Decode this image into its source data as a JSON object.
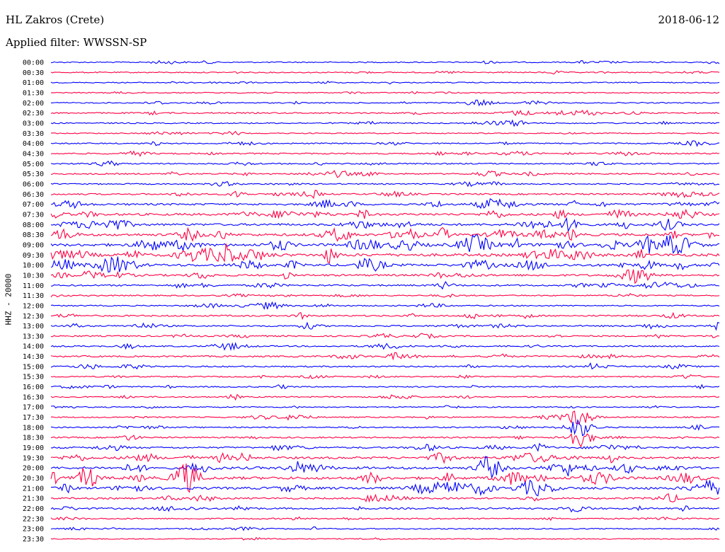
{
  "header": {
    "station": "HL Zakros (Crete)",
    "date": "2018-06-12",
    "filter_label": "Applied filter: WWSSN-SP"
  },
  "chart_data": {
    "type": "line",
    "title": "HL Zakros (Crete)",
    "subtitle": "Applied filter: WWSSN-SP",
    "ylabel": "HHZ - 20000",
    "colors": {
      "even_rows": "#0000ff",
      "odd_rows": "#ff0044"
    },
    "rows": [
      "00:00",
      "00:30",
      "01:00",
      "01:30",
      "02:00",
      "02:30",
      "03:00",
      "03:30",
      "04:00",
      "04:30",
      "05:00",
      "05:30",
      "06:00",
      "06:30",
      "07:00",
      "07:30",
      "08:00",
      "08:30",
      "09:00",
      "09:30",
      "10:00",
      "10:30",
      "11:00",
      "11:30",
      "12:00",
      "12:30",
      "13:00",
      "13:30",
      "14:00",
      "14:30",
      "15:00",
      "15:30",
      "16:00",
      "16:30",
      "17:00",
      "17:30",
      "18:00",
      "18:30",
      "19:00",
      "19:30",
      "20:00",
      "20:30",
      "21:00",
      "21:30",
      "22:00",
      "22:30",
      "23:00",
      "23:30"
    ],
    "noise_level": [
      1,
      1,
      0.8,
      0.8,
      1,
      1.5,
      1.2,
      0.8,
      1.2,
      1.5,
      1.3,
      1.5,
      1.2,
      1.8,
      2.5,
      3,
      3,
      3.5,
      4,
      4,
      3.5,
      2.5,
      2,
      1.2,
      1.2,
      1.8,
      1.8,
      1.5,
      1.5,
      1.8,
      1.5,
      1.2,
      1.2,
      1.2,
      1,
      1.2,
      1.2,
      1.5,
      2,
      3,
      3.5,
      4,
      3.5,
      2,
      2,
      1.2,
      1,
      0.6
    ],
    "events": [
      {
        "row": "08:30",
        "time_fraction": 0.53,
        "amplitude": 6
      },
      {
        "row": "09:00",
        "time_fraction": 0.53,
        "amplitude": 5
      },
      {
        "row": "17:30",
        "time_fraction": 0.79,
        "amplitude": 8
      },
      {
        "row": "18:00",
        "time_fraction": 0.79,
        "amplitude": 9
      },
      {
        "row": "18:30",
        "time_fraction": 0.79,
        "amplitude": 9
      },
      {
        "row": "21:00",
        "time_fraction": 0.12,
        "amplitude": 4
      },
      {
        "row": "02:00",
        "time_fraction": 0.64,
        "amplitude": 3
      },
      {
        "row": "05:30",
        "time_fraction": 0.43,
        "amplitude": 3
      }
    ]
  }
}
